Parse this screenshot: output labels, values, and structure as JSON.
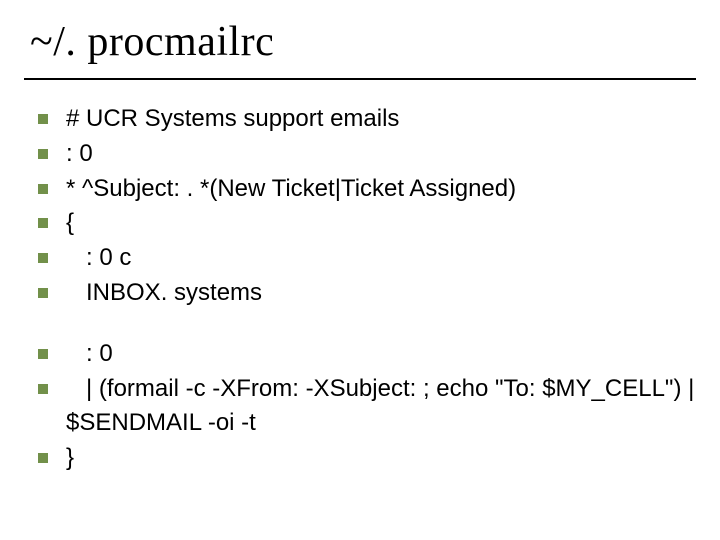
{
  "title": "~/. procmailrc",
  "bullets_group1": [
    "# UCR Systems support emails",
    ": 0",
    "* ^Subject: . *(New Ticket|Ticket Assigned)",
    "{",
    "   : 0 c",
    "   INBOX. systems"
  ],
  "bullets_group2": [
    "   : 0",
    "   | (formail -c -XFrom: -XSubject: ; echo \"To: $MY_CELL\") | $SENDMAIL -oi -t",
    "}"
  ]
}
